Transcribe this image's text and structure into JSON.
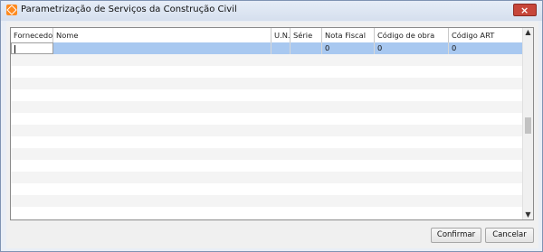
{
  "window": {
    "title": "Parametrização de Serviços da Construção Civil",
    "close_symbol": "×"
  },
  "grid": {
    "columns": [
      "Fornecedor",
      "Nome",
      "U.N.",
      "Série",
      "Nota Fiscal",
      "Código de obra",
      "Código ART"
    ],
    "rows": [
      [
        "",
        "",
        "",
        "",
        "0",
        "0",
        "0"
      ]
    ]
  },
  "buttons": {
    "confirm": "Confirmar",
    "cancel": "Cancelar"
  },
  "icons": {
    "app": "app-icon",
    "close": "close-icon",
    "scroll_up": "chevron-up-icon",
    "scroll_down": "chevron-down-icon"
  },
  "colors": {
    "selected_row": "#a8c8f0",
    "title_bar": "#dbe4f1",
    "close_button": "#c7463a"
  }
}
